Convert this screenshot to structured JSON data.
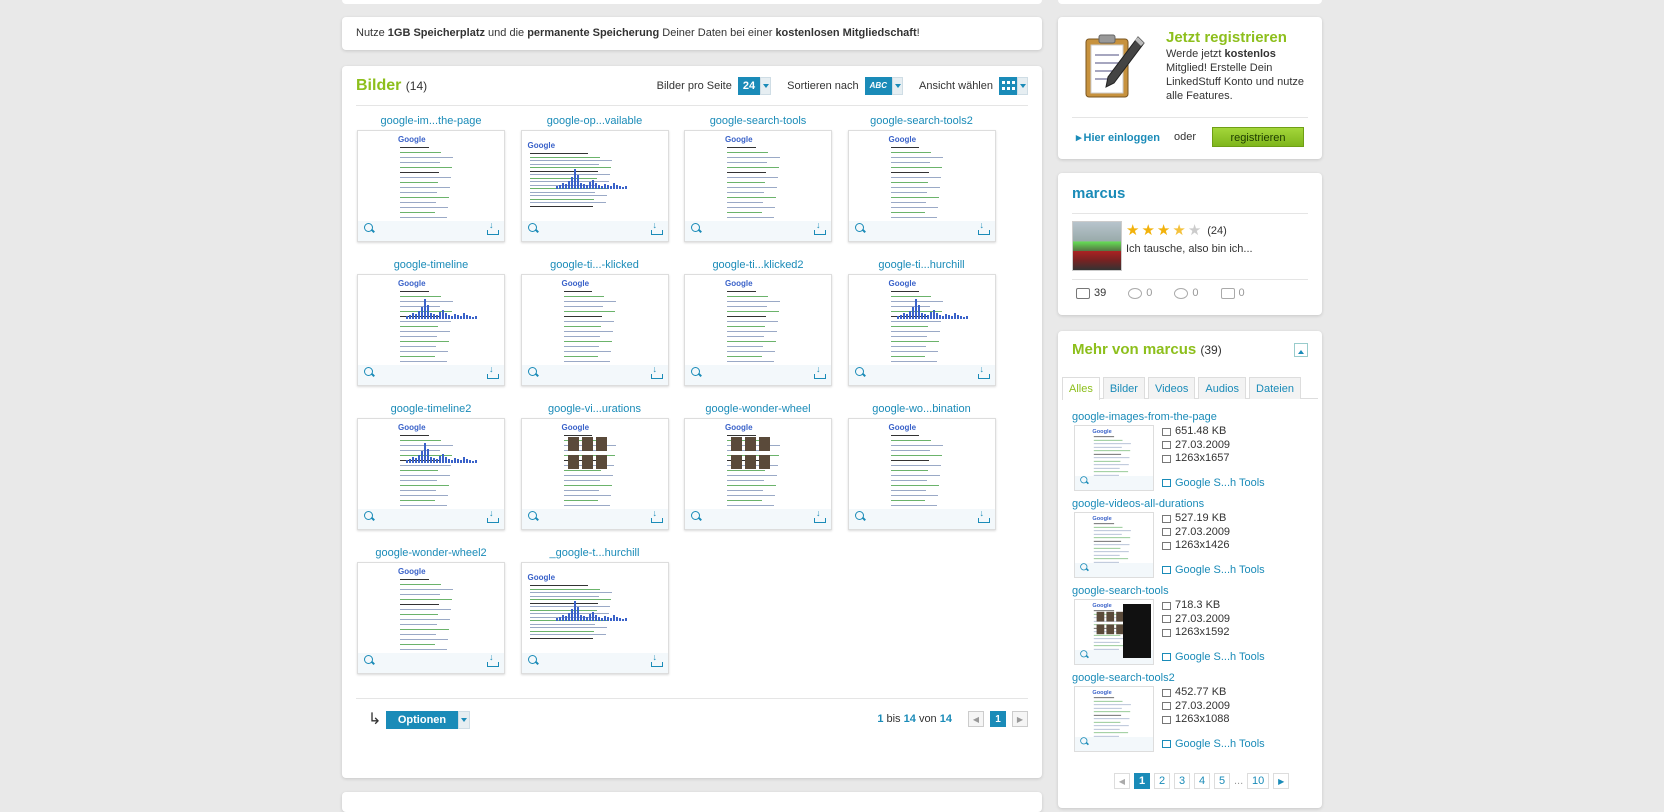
{
  "promo": {
    "p1": "Nutze ",
    "b1": "1GB Speicherplatz",
    "p2": " und die ",
    "b2": "permanente Speicherung",
    "p3": " Deiner Daten bei einer ",
    "b3": "kostenlosen Mitgliedschaft",
    "p4": "!"
  },
  "images": {
    "title": "Bilder",
    "count": "(14)",
    "per_page_label": "Bilder pro Seite",
    "per_page_value": "24",
    "sort_label": "Sortieren nach",
    "sort_value": "ABC",
    "view_label": "Ansicht wählen",
    "items": [
      {
        "caption": "google-im...the-page"
      },
      {
        "caption": "google-op...vailable"
      },
      {
        "caption": "google-search-tools"
      },
      {
        "caption": "google-search-tools2"
      },
      {
        "caption": "google-timeline"
      },
      {
        "caption": "google-ti...-klicked"
      },
      {
        "caption": "google-ti...klicked2"
      },
      {
        "caption": "google-ti...hurchill"
      },
      {
        "caption": "google-timeline2"
      },
      {
        "caption": "google-vi...urations"
      },
      {
        "caption": "google-wonder-wheel"
      },
      {
        "caption": "google-wo...bination"
      },
      {
        "caption": "google-wonder-wheel2"
      },
      {
        "caption": "_google-t...hurchill"
      }
    ],
    "options_label": "Optionen",
    "pager": {
      "from": "1",
      "to_word": "bis",
      "to": "14",
      "of_word": "von",
      "total": "14",
      "current": "1"
    }
  },
  "register": {
    "title": "Jetzt registrieren",
    "text_p1": "Werde jetzt ",
    "text_b": "kostenlos",
    "text_p2": " Mitglied! Erstelle Dein LinkedStuff Konto und nutze alle Features.",
    "login": "Hier einloggen",
    "or": "oder",
    "button": "registrieren"
  },
  "user": {
    "name": "marcus",
    "rating": 3.5,
    "votes": "(24)",
    "motto": "Ich tausche, also bin ich...",
    "stats": [
      "39",
      "0",
      "0",
      "0"
    ]
  },
  "more": {
    "title": "Mehr von marcus",
    "count": "(39)",
    "tabs": [
      "Alles",
      "Bilder",
      "Videos",
      "Audios",
      "Dateien"
    ],
    "items": [
      {
        "title": "google-images-from-the-page",
        "size": "651.48 KB",
        "date": "27.03.2009",
        "dims": "1263x1657",
        "album": "Google S...h Tools"
      },
      {
        "title": "google-videos-all-durations",
        "size": "527.19 KB",
        "date": "27.03.2009",
        "dims": "1263x1426",
        "album": "Google S...h Tools"
      },
      {
        "title": "google-search-tools",
        "size": "718.3 KB",
        "date": "27.03.2009",
        "dims": "1263x1592",
        "album": "Google S...h Tools"
      },
      {
        "title": "google-search-tools2",
        "size": "452.77 KB",
        "date": "27.03.2009",
        "dims": "1263x1088",
        "album": "Google S...h Tools"
      }
    ],
    "pages": [
      "1",
      "2",
      "3",
      "4",
      "5",
      "...",
      "10"
    ]
  }
}
